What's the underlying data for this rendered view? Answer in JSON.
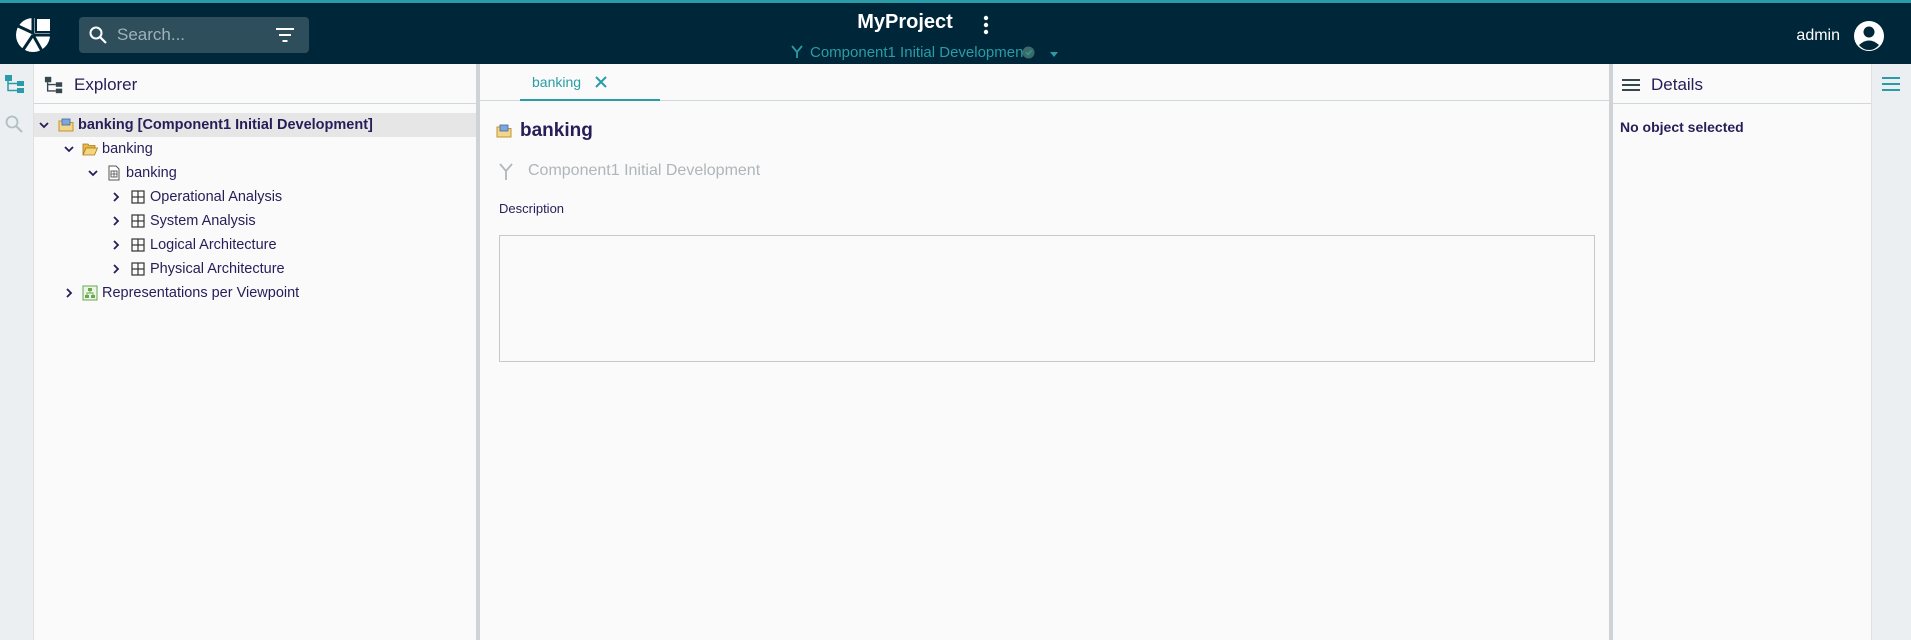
{
  "header": {
    "project_title": "MyProject",
    "branch_label": "Component1 Initial Development",
    "search_placeholder": "Search...",
    "user_name": "admin"
  },
  "explorer": {
    "title": "Explorer",
    "tree": [
      {
        "label": "banking [Component1 Initial Development]",
        "level": 0,
        "expanded": true,
        "icon": "project-folder-icon",
        "selected": true
      },
      {
        "label": "banking",
        "level": 1,
        "expanded": true,
        "icon": "open-folder-icon"
      },
      {
        "label": "banking",
        "level": 2,
        "expanded": true,
        "icon": "model-icon"
      },
      {
        "label": "Operational Analysis",
        "level": 3,
        "expanded": false,
        "icon": "grid-icon"
      },
      {
        "label": "System Analysis",
        "level": 3,
        "expanded": false,
        "icon": "grid-icon"
      },
      {
        "label": "Logical Architecture",
        "level": 3,
        "expanded": false,
        "icon": "grid-icon"
      },
      {
        "label": "Physical Architecture",
        "level": 3,
        "expanded": false,
        "icon": "grid-icon"
      },
      {
        "label": "Representations per Viewpoint",
        "level": 1,
        "expanded": false,
        "icon": "diagram-icon"
      }
    ]
  },
  "editor": {
    "tab_label": "banking",
    "object_title": "banking",
    "object_branch": "Component1 Initial Development",
    "description_label": "Description",
    "description_value": ""
  },
  "details": {
    "title": "Details",
    "empty_message": "No object selected"
  },
  "colors": {
    "topbar": "#002639",
    "accent": "#2a9ca7",
    "text": "#261e58"
  }
}
